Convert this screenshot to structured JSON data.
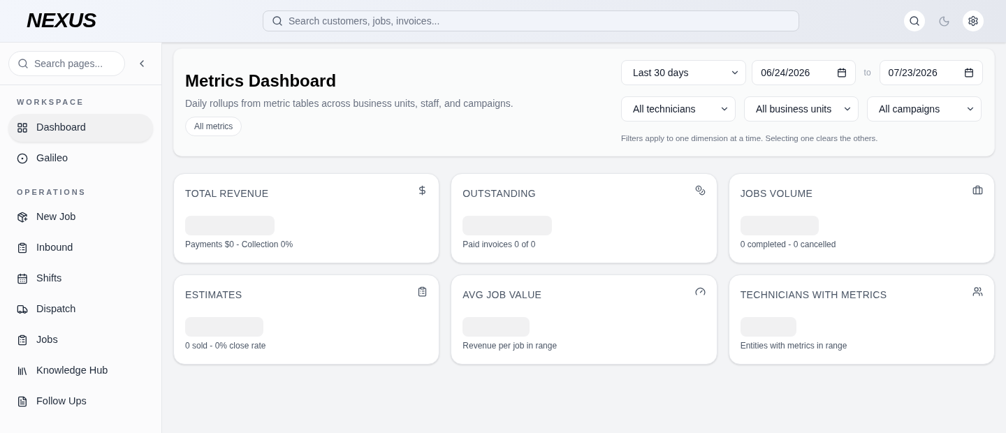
{
  "header": {
    "logo": "NEXUS",
    "search": {
      "placeholder": "Search customers, jobs, invoices..."
    }
  },
  "sidebar": {
    "search": {
      "placeholder": "Search pages..."
    },
    "sections": [
      {
        "title": "WORKSPACE",
        "items": [
          {
            "label": "Dashboard",
            "selected": true
          },
          {
            "label": "Galileo",
            "selected": false
          }
        ]
      },
      {
        "title": "OPERATIONS",
        "items": [
          {
            "label": "New Job",
            "selected": false
          },
          {
            "label": "Inbound",
            "selected": false
          },
          {
            "label": "Shifts",
            "selected": false
          },
          {
            "label": "Dispatch",
            "selected": false
          },
          {
            "label": "Jobs",
            "selected": false
          },
          {
            "label": "Knowledge Hub",
            "selected": false
          },
          {
            "label": "Follow Ups",
            "selected": false
          }
        ]
      }
    ]
  },
  "page": {
    "title": "Metrics Dashboard",
    "subtitle": "Daily rollups from metric tables across business units, staff, and campaigns.",
    "chip": "All metrics",
    "range": "Last 30 days",
    "date_from": "06/24/2026",
    "to": "to",
    "date_to": "07/23/2026",
    "filters": [
      "All technicians",
      "All business units",
      "All campaigns"
    ],
    "note": "Filters apply to one dimension at a time. Selecting one clears the others."
  },
  "cards": [
    {
      "title": "TOTAL REVENUE",
      "caption": "Payments $0 - Collection 0%"
    },
    {
      "title": "OUTSTANDING",
      "caption": "Paid invoices 0 of 0"
    },
    {
      "title": "JOBS VOLUME",
      "caption": "0 completed - 0 cancelled"
    },
    {
      "title": "ESTIMATES",
      "caption": "0 sold - 0% close rate"
    },
    {
      "title": "AVG JOB VALUE",
      "caption": "Revenue per job in range"
    },
    {
      "title": "TECHNICIANS WITH METRICS",
      "caption": "Entities with metrics in range"
    }
  ]
}
